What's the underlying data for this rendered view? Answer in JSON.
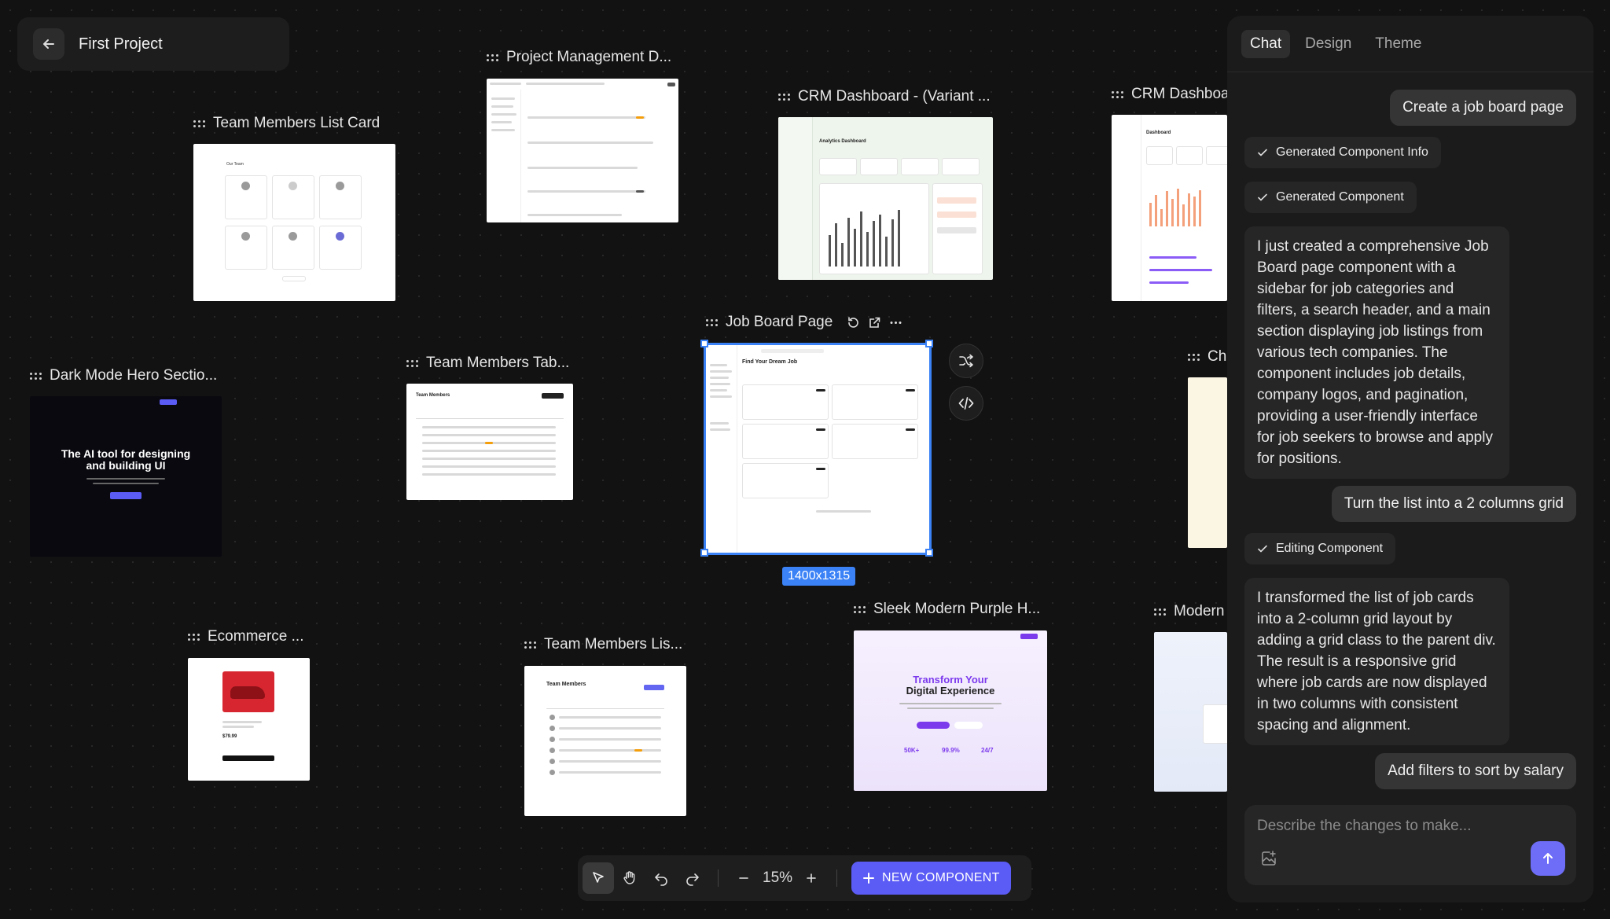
{
  "project": {
    "title": "First Project"
  },
  "cards": [
    {
      "label": "Project Management D..."
    },
    {
      "label": "Team Members List Card"
    },
    {
      "label": "CRM Dashboard - (Variant ..."
    },
    {
      "label": "CRM Dashboa"
    },
    {
      "label": "Dark Mode Hero Sectio..."
    },
    {
      "label": "Team Members Tab..."
    },
    {
      "label": "Job Board Page"
    },
    {
      "label": "Ch"
    },
    {
      "label": "Ecommerce ..."
    },
    {
      "label": "Team Members Lis..."
    },
    {
      "label": "Sleek Modern Purple H..."
    },
    {
      "label": "Modern"
    }
  ],
  "thumb_text": {
    "team_list_heading": "Our Team",
    "analytics": "Analytics Dashboard",
    "dashboard": "Dashboard",
    "hero_title": "The AI tool for designing and building UI",
    "team_members": "Team Members",
    "job_heading": "Find Your Dream Job",
    "purple_title": "Transform Your",
    "purple_title2": "Digital Experience",
    "stat1": "50K+",
    "stat2": "99.9%",
    "stat3": "24/7",
    "product_price": "$79.99"
  },
  "selection": {
    "dimensions": "1400x1315"
  },
  "toolbar": {
    "zoom": "15%",
    "new_component": "NEW COMPONENT"
  },
  "panel": {
    "tabs": [
      {
        "label": "Chat"
      },
      {
        "label": "Design"
      },
      {
        "label": "Theme"
      }
    ],
    "messages": {
      "user1": "Create a job board page",
      "status1": "Generated Component Info",
      "status2": "Generated Component",
      "ai1": "I just created a comprehensive Job Board page component with a sidebar for job categories and filters, a search header, and a main section displaying job listings from various tech companies. The component includes job details, company logos, and pagination, providing a user-friendly interface for job seekers to browse and apply for positions.",
      "user2": "Turn the list into a 2 columns grid",
      "status3": "Editing Component",
      "ai2": "I transformed the list of job cards into a 2-column grid layout by adding a grid class to the parent div. The result is a responsive grid where job cards are now displayed in two columns with consistent spacing and alignment.",
      "user3": "Add filters to sort by salary"
    },
    "composer_placeholder": "Describe the changes to make..."
  },
  "colors": {
    "accent": "#5b5bf6",
    "selection": "#3b82f6",
    "background": "#121212",
    "panel": "#1b1b1b"
  }
}
